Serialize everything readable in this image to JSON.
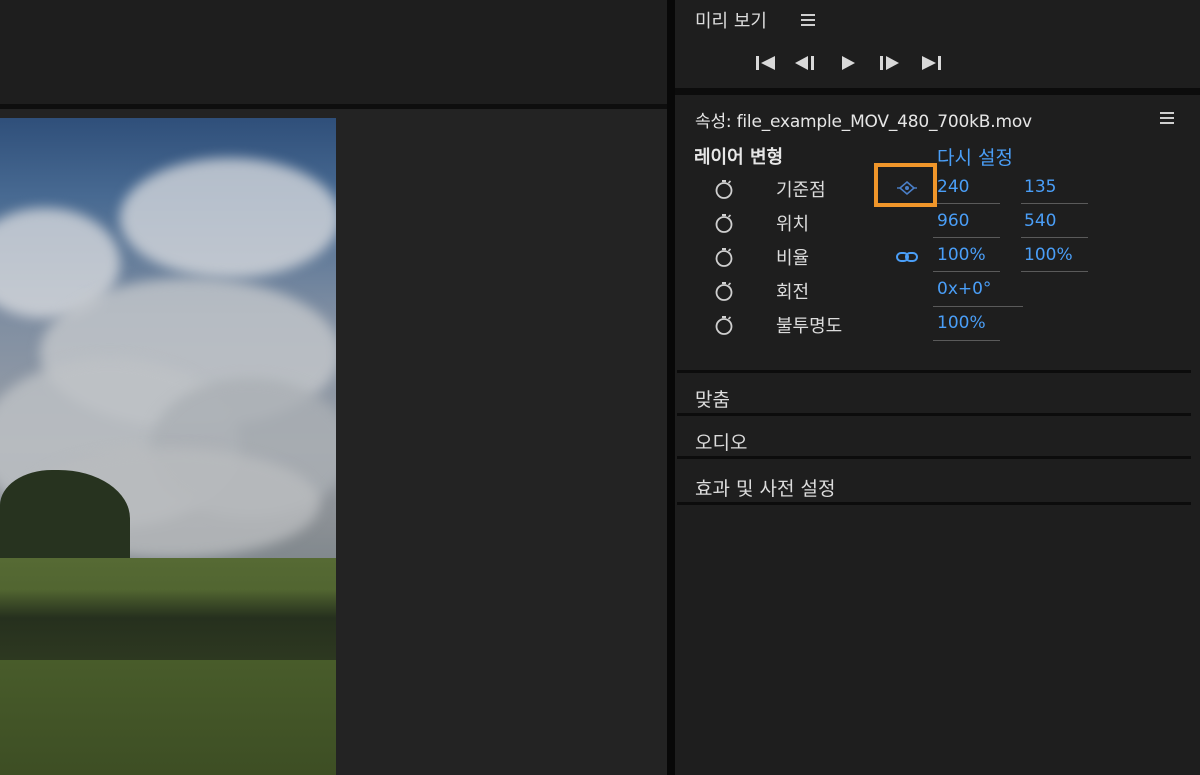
{
  "preview": {
    "title": "미리 보기",
    "controls": [
      "go-to-start",
      "step-back",
      "play",
      "step-forward",
      "go-to-end"
    ]
  },
  "properties": {
    "title": "속성: file_example_MOV_480_700kB.mov",
    "layer_transform": {
      "label": "레이어 변형",
      "reset_label": "다시 설정",
      "rows": [
        {
          "name": "기준점",
          "v1": "240",
          "v2": "135"
        },
        {
          "name": "위치",
          "v1": "960",
          "v2": "540"
        },
        {
          "name": "비율",
          "v1": "100%",
          "v2": "100%"
        },
        {
          "name": "회전",
          "v1": "0x+0°"
        },
        {
          "name": "불투명도",
          "v1": "100%"
        }
      ]
    },
    "sections": [
      {
        "label": "맞춤"
      },
      {
        "label": "오디오"
      },
      {
        "label": "효과 및 사전 설정"
      }
    ]
  },
  "colors": {
    "accent": "#4a9ef7",
    "highlight": "#f0962a",
    "background": "#1e1e1e"
  }
}
